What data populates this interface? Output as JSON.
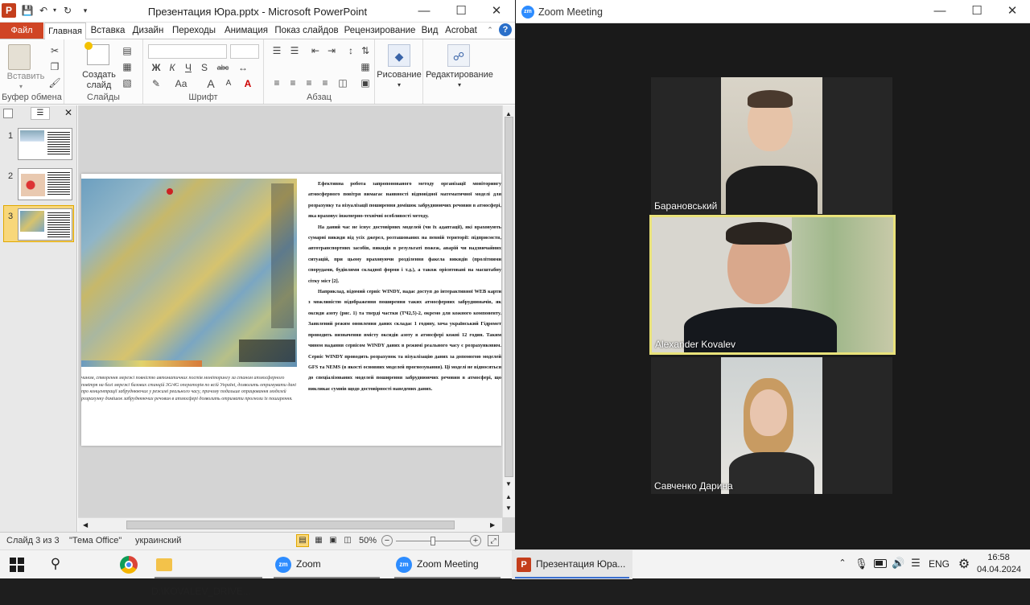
{
  "ppt": {
    "title": "Презентация Юра.pptx  -  Microsoft PowerPoint",
    "tabs": [
      "Файл",
      "Главная",
      "Вставка",
      "Дизайн",
      "Переходы",
      "Анимация",
      "Показ слайдов",
      "Рецензирование",
      "Вид",
      "Acrobat"
    ],
    "ribbon": {
      "paste": "Вставить",
      "create_slide_1": "Создать",
      "create_slide_2": "слайд",
      "drawing": "Рисование",
      "editing": "Редактирование",
      "groups": [
        "Буфер обмена",
        "Слайды",
        "Шрифт",
        "Абзац"
      ],
      "font_buttons": [
        "Ж",
        "К",
        "Ч",
        "S",
        "abc",
        "Аа",
        "А",
        "А"
      ]
    },
    "thumbs": [
      "1",
      "2",
      "3"
    ],
    "slide": {
      "paragraphs": [
        "Ефективна робота запропонованого методу організації моніторингу атмосферного повітря вимагає наявності відповідної математичної моделі для розрахунку та візуалізації поширення домішок забруднюючих речовин в атмосфері, яка враховує інженерно-технічні особливості методу.",
        "На даний час не існує достовірних моделей (чи їх адаптації), які враховують сумарні викиди від усіх джерел, розташованих на певній території: підприємств, автотранспортних засобів, викидів в результаті пожеж, аварій чи надзвичайних ситуацій, при цьому враховуючи розділення факела викидів (пролітними спорудами, будівлями складної форми і т.д.), а також орієнтовані на масштабну сітку міст [2].",
        "Наприклад, відомий сервіс WINDY, надає доступ до інтерактивної WEB карти з можливістю відображення поширення таких атмосферних забруднювачів, як оксиди азоту (рис. 1) та тверді частки (ТЧ2,5)-2, окремо для кожного компоненту. Заявлений режим оновлення даних складає 1 годину, хоча український Гідромет проводить визначення вмісту оксидів азоту в атмосфері кожні 12 годин. Таким чином надання сервісом WINDY даних в режимі реального часу є розрахунковим. Сервіс WINDY проводить розрахунок та візуалізацію даних за допомогою моделей GFS та NEMS (в якості основних моделей прогнозування). Ці моделі не відносяться до спеціалізованих моделей поширення забруднюючих речовин в атмосфері, що викликає сумнів щодо достовірності наведених даних."
      ],
      "caption": "чином, створення мережі повністю автоматичних постів моніторингу за станом атмосферного повітря на базі мережі базових станцій 3G/4G операторів по всій Україні, дозволить отримувати дані про концентрації забруднюючих у режимі реального часу, причому подальше опрацювання моделей розрахунку домішок забруднюючих речовин в атмосфері дозволить отримати прогнози їх поширення."
    },
    "status": {
      "slide": "Слайд 3 из 3",
      "theme": "\"Тема Office\"",
      "lang": "украинский",
      "zoom": "50%",
      "zoom_level": 50
    }
  },
  "zoom": {
    "title": "Zoom Meeting",
    "participants": [
      "Барановський",
      "Alexander Kovalev",
      "Савченко Дарина"
    ],
    "active_color": "#e9e27a"
  },
  "taskbar": {
    "items": [
      "D:\\KOVALEV_DRIVE...",
      "Zoom",
      "Zoom Meeting",
      "Презентация Юра..."
    ],
    "lang": "ENG",
    "time": "16:58",
    "date": "04.04.2024"
  }
}
